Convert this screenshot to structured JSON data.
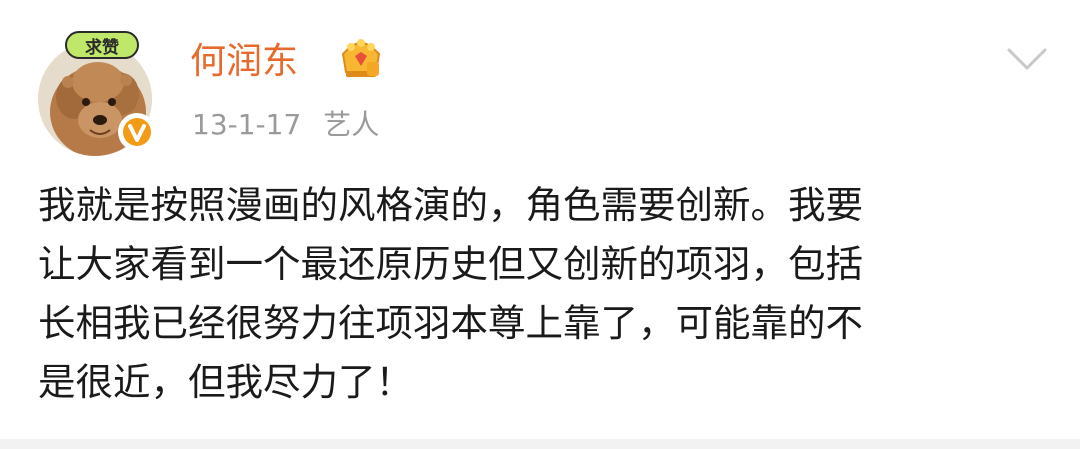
{
  "user": {
    "name": "何润东",
    "avatar_badge": "求赞",
    "verified_icon": "orange-v-verified-icon",
    "vip_icon": "crown-icon"
  },
  "meta": {
    "date": "13-1-17",
    "tag": "艺人"
  },
  "menu_icon": "chevron-down-icon",
  "post": {
    "lines": [
      "我就是按照漫画的风格演的，角色需要创新。我要",
      "让大家看到一个最还原历史但又创新的项羽，包括",
      "长相我已经很努力往项羽本尊上靠了，可能靠的不",
      "是很近，但我尽力了！"
    ]
  },
  "colors": {
    "username": "#e8692c",
    "meta": "#9a9a9a",
    "text": "#1a1a1a",
    "verified": "#f29b17"
  }
}
